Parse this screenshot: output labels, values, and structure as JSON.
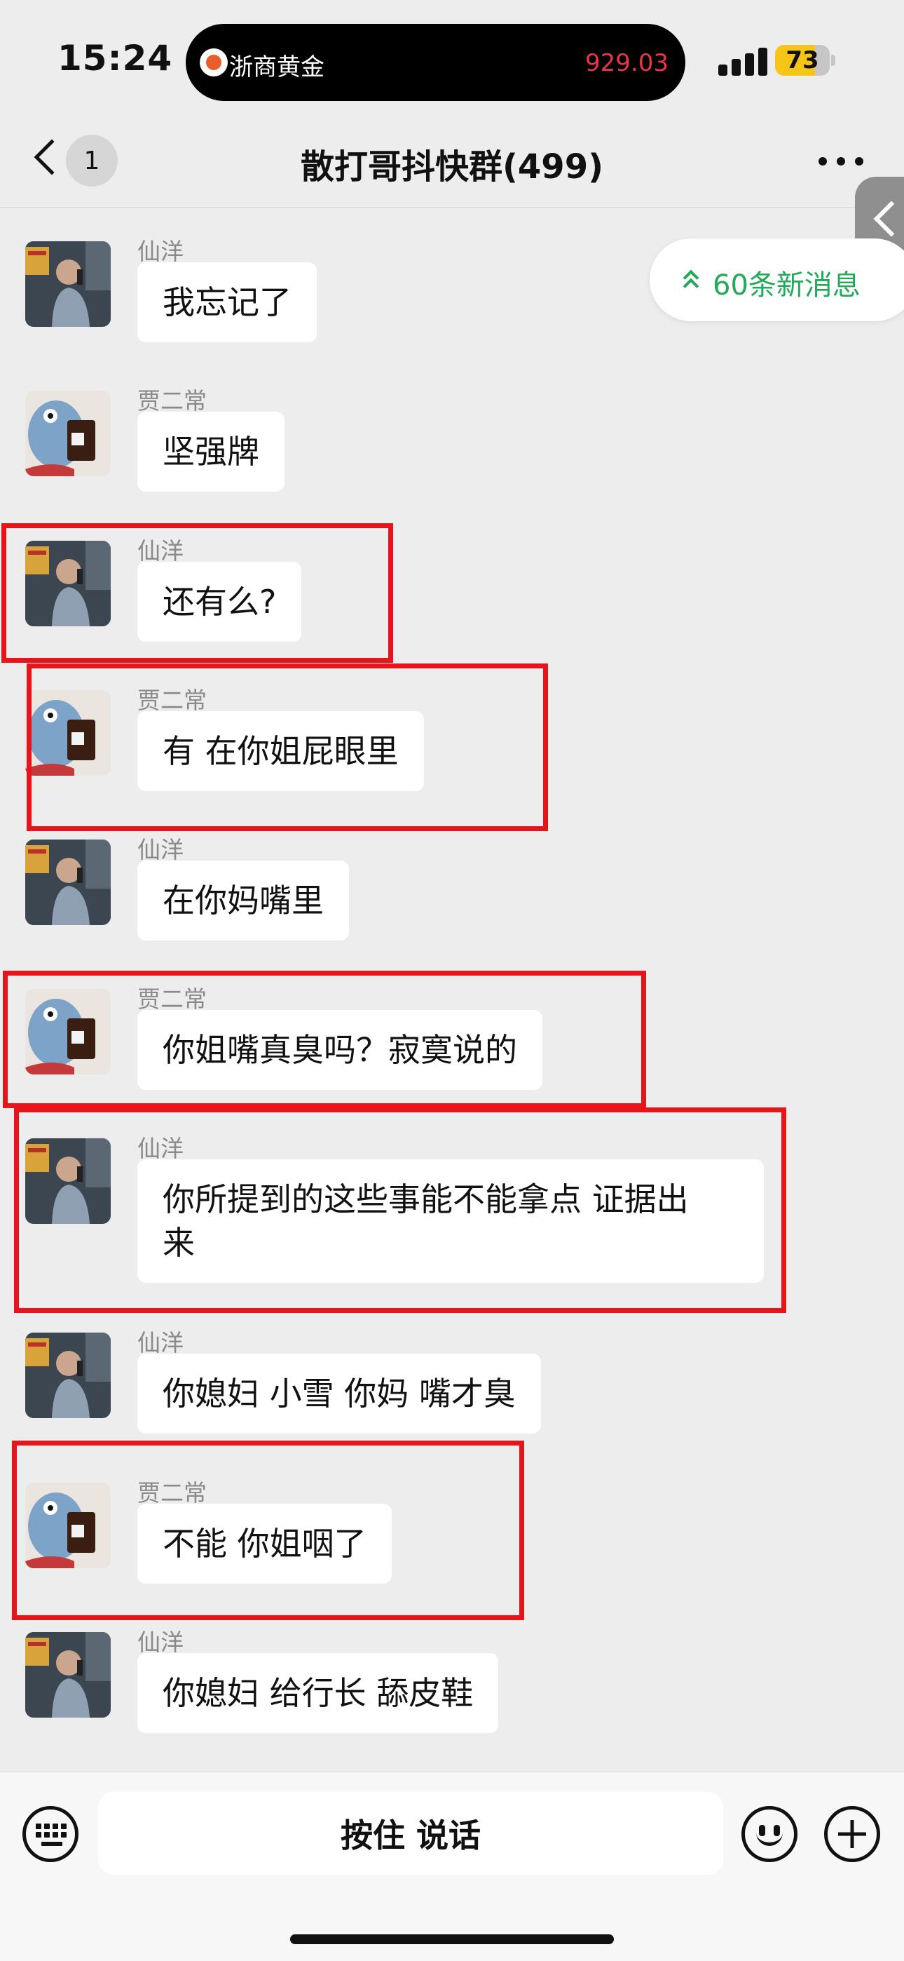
{
  "status_bar": {
    "time": "15:24",
    "live_activity": {
      "name": "浙商黄金",
      "value": "929.03",
      "value_color": "#e8354a"
    },
    "battery": {
      "level": 73,
      "fill_color": "#f5c518"
    }
  },
  "header": {
    "unread_count": "1",
    "title": "散打哥抖快群(499)",
    "icons": {
      "back": "chevron-left-icon",
      "more": "more-dots-icon"
    }
  },
  "new_messages_pill": {
    "label": "60条新消息",
    "color": "#23a95a"
  },
  "highlight_color": "#e8141c",
  "messages": [
    {
      "sender": "仙洋",
      "text": "我忘记了",
      "avatar": "street-photo-avatar"
    },
    {
      "sender": "贾二常",
      "text": "坚强牌",
      "avatar": "coffee-plush-avatar"
    },
    {
      "sender": "仙洋",
      "text": "还有么?",
      "avatar": "street-photo-avatar",
      "highlighted": true
    },
    {
      "sender": "贾二常",
      "text": "有 在你姐屁眼里",
      "avatar": "coffee-plush-avatar",
      "highlighted": true
    },
    {
      "sender": "仙洋",
      "text": "在你妈嘴里",
      "avatar": "street-photo-avatar"
    },
    {
      "sender": "贾二常",
      "text": "你姐嘴真臭吗？寂寞说的",
      "avatar": "coffee-plush-avatar",
      "highlighted": true
    },
    {
      "sender": "仙洋",
      "text": "你所提到的这些事能不能拿点 证据出\n来",
      "avatar": "street-photo-avatar",
      "highlighted": true
    },
    {
      "sender": "仙洋",
      "text": "你媳妇 小雪 你妈 嘴才臭",
      "avatar": "street-photo-avatar"
    },
    {
      "sender": "贾二常",
      "text": "不能 你姐咽了",
      "avatar": "coffee-plush-avatar",
      "highlighted": true
    },
    {
      "sender": "仙洋",
      "text": "你媳妇 给行长 舔皮鞋",
      "avatar": "street-photo-avatar"
    }
  ],
  "input_bar": {
    "talk_label": "按住 说话",
    "icons": {
      "left": "keyboard-icon",
      "emoji": "emoji-icon",
      "plus": "plus-icon"
    }
  }
}
